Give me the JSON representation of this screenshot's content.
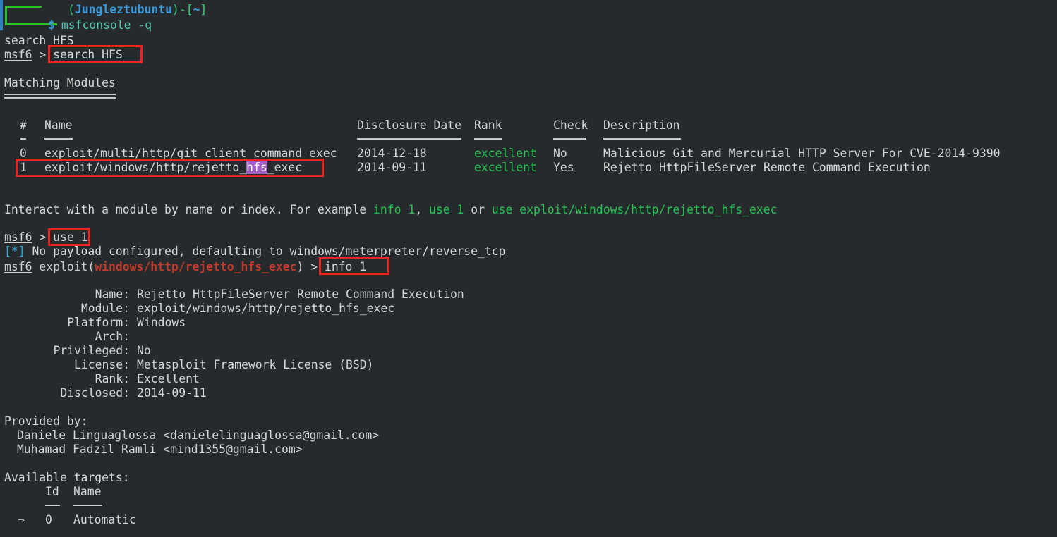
{
  "terminal": {
    "title": "msfconsole",
    "colors": {
      "background": "#262a2d",
      "foreground": "#d8d8d8",
      "green": "#33d17a",
      "blue": "#3a9bdc",
      "cyan": "#2aa8e0",
      "red_annotation": "#ef2222",
      "highlight_purple": "#a05ec4",
      "module_red": "#c0392b",
      "prompt_green": "#26c426",
      "gutter_blue": "#2f7fbf"
    }
  },
  "shell_prompt": {
    "user": "Junglezt",
    "separator_icon": "㈟",
    "host": "ubuntu",
    "open_paren": "(",
    "close_paren": ")",
    "dash": "-",
    "path_open": "[",
    "path": "~",
    "path_close": "]",
    "dollar": "$",
    "command": "msfconsole -q"
  },
  "echoed_command": "search HFS",
  "msf": {
    "prompt_name": "msf6",
    "prompt_arrow": ">",
    "search_command": "search HFS",
    "use_command": "use 1",
    "info_command": "info 1",
    "module_prompt_prefix": "msf6 exploit(",
    "module_prompt_module": "windows/http/rejetto_hfs_exec",
    "module_prompt_suffix": ") >",
    "payload_notice_marker": "[*]",
    "payload_notice": "No payload configured, defaulting to windows/meterpreter/reverse_tcp"
  },
  "matching_modules": {
    "heading": "Matching Modules",
    "headers": [
      "#",
      "Name",
      "Disclosure Date",
      "Rank",
      "Check",
      "Description"
    ],
    "header_rules": [
      "-",
      "———",
      "———",
      "——",
      "——",
      "———"
    ],
    "rows": [
      {
        "id": "0",
        "name": "exploit/multi/http/git_client_command_exec",
        "disclosure_date": "2014-12-18",
        "rank": "excellent",
        "check": "No",
        "description": "Malicious Git and Mercurial HTTP Server For CVE-2014-9390"
      },
      {
        "id": "1",
        "name_prefix": "exploit/windows/http/rejetto_",
        "name_highlight": "hfs",
        "name_suffix": "_exec",
        "name": "exploit/windows/http/rejetto_hfs_exec",
        "disclosure_date": "2014-09-11",
        "rank": "excellent",
        "check": "Yes",
        "description": "Rejetto HttpFileServer Remote Command Execution"
      }
    ]
  },
  "interact_hint": {
    "part1": "Interact with a module by name or index. For example ",
    "example1": "info 1",
    "comma": ", ",
    "example2": "use 1",
    "or": " or ",
    "example3": "use exploit/windows/http/rejetto_hfs_exec"
  },
  "module_info": {
    "fields": [
      {
        "label": "Name:",
        "value": "Rejetto HttpFileServer Remote Command Execution"
      },
      {
        "label": "Module:",
        "value": "exploit/windows/http/rejetto_hfs_exec"
      },
      {
        "label": "Platform:",
        "value": "Windows"
      },
      {
        "label": "Arch:",
        "value": ""
      },
      {
        "label": "Privileged:",
        "value": "No"
      },
      {
        "label": "License:",
        "value": "Metasploit Framework License (BSD)"
      },
      {
        "label": "Rank:",
        "value": "Excellent"
      },
      {
        "label": "Disclosed:",
        "value": "2014-09-11"
      }
    ]
  },
  "provided_by": {
    "heading": "Provided by:",
    "authors": [
      "Daniele Linguaglossa <danielelinguaglossa@gmail.com>",
      "Muhamad Fadzil Ramli <mind1355@gmail.com>"
    ]
  },
  "available_targets": {
    "heading": "Available targets:",
    "headers": [
      "Id",
      "Name"
    ],
    "rules": [
      "--",
      "————"
    ],
    "rows": [
      {
        "marker": "⇒",
        "id": "0",
        "name": "Automatic"
      }
    ]
  },
  "annotations": {
    "boxes": [
      {
        "name": "search-command-box",
        "label": "search HFS"
      },
      {
        "name": "module-row-box",
        "label": "exploit/windows/http/rejetto_hfs_exec"
      },
      {
        "name": "use-command-box",
        "label": "use 1"
      },
      {
        "name": "info-command-box",
        "label": "info 1"
      }
    ]
  }
}
